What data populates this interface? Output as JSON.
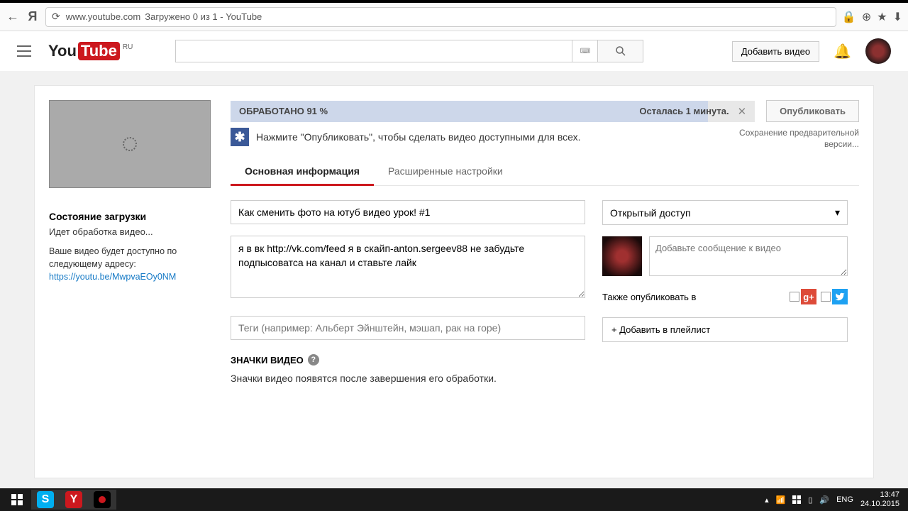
{
  "browser": {
    "url": "www.youtube.com",
    "title": "Загружено 0 из 1 - YouTube"
  },
  "header": {
    "region": "RU",
    "upload_button": "Добавить видео"
  },
  "upload": {
    "progress_label": "ОБРАБОТАНО 91 %",
    "progress_pct": 91,
    "time_remaining": "Осталась 1 минута.",
    "publish_button": "Опубликовать",
    "info_message": "Нажмите \"Опубликовать\", чтобы сделать видео доступными для всех.",
    "saving_message": "Сохранение предварительной версии..."
  },
  "status_panel": {
    "title": "Состояние загрузки",
    "processing": "Идет обработка видео...",
    "availability": "Ваше видео будет доступно по следующему адресу:",
    "video_url": "https://youtu.be/MwpvaEOy0NM"
  },
  "tabs": {
    "basic": "Основная информация",
    "advanced": "Расширенные настройки"
  },
  "form": {
    "title_value": "Как сменить фото на ютуб видео урок! #1",
    "description_value": "я в вк http://vk.com/feed я в скайп-anton.sergeev88 не забудьте подпысоватса на канал и ставьте лайк",
    "tags_placeholder": "Теги (например: Альберт Эйнштейн, мэшап, рак на горе)",
    "privacy_value": "Открытый доступ",
    "share_message_placeholder": "Добавьте сообщение к видео",
    "also_publish": "Также опубликовать в",
    "add_playlist": "+ Добавить в плейлист"
  },
  "thumbnails": {
    "section_title": "ЗНАЧКИ ВИДЕО",
    "pending_text": "Значки видео появятся после завершения его обработки."
  },
  "taskbar": {
    "lang": "ENG",
    "time": "13:47",
    "date": "24.10.2015"
  }
}
